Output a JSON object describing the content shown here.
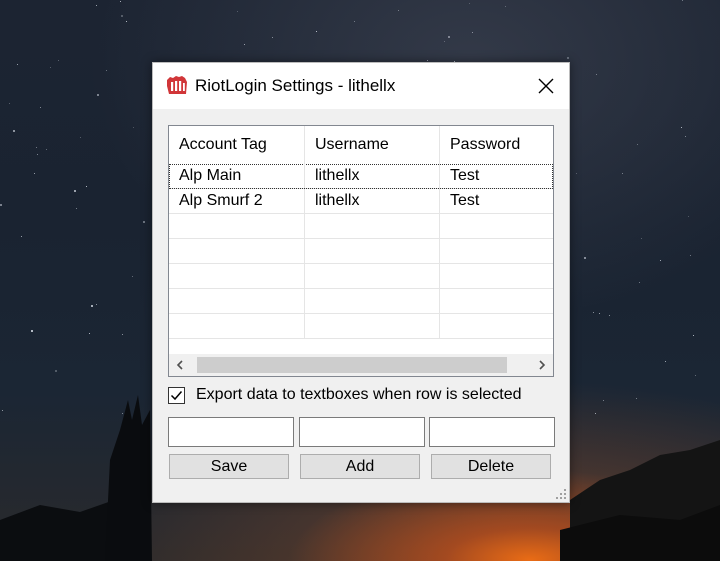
{
  "window": {
    "title": "RiotLogin Settings - lithellx",
    "app_icon": "riot-fist-icon",
    "close_icon": "close-icon",
    "accent_color": "#d13639"
  },
  "grid": {
    "columns": [
      "Account Tag",
      "Username",
      "Password"
    ],
    "rows": [
      [
        "Alp Main",
        "lithellx",
        "Test"
      ],
      [
        "Alp Smurf 2",
        "lithellx",
        "Test"
      ]
    ],
    "empty_rows": 5,
    "scroll_left_icon": "chevron-left-icon",
    "scroll_right_icon": "chevron-right-icon"
  },
  "export_option": {
    "label": "Export data to textboxes when row is selected",
    "checked": true
  },
  "inputs": {
    "account_tag": "",
    "username": "",
    "password": ""
  },
  "buttons": {
    "save": "Save",
    "add": "Add",
    "delete": "Delete"
  }
}
